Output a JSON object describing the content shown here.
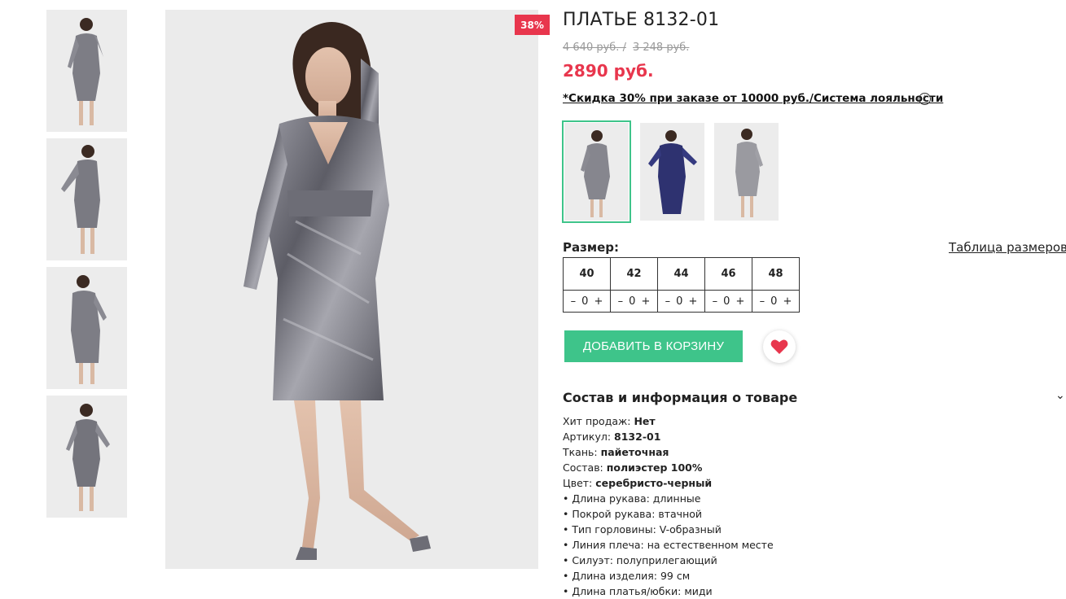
{
  "badge": {
    "discount": "38%"
  },
  "product": {
    "title": "ПЛАТЬЕ 8132-01",
    "old_price_1": "4 640 руб. /",
    "old_price_2": "3 248 руб.",
    "price": "2890 руб.",
    "promo_link": "*Скидка 30% при заказе от 10000 руб./Система лояльности"
  },
  "colors": {
    "silver": "#8a8a92",
    "navy": "#2e3270",
    "accent_green": "#3ec48a",
    "accent_red": "#e8364d"
  },
  "sizes": {
    "label": "Размер:",
    "table_link": "Таблица размеров",
    "items": [
      {
        "size": "40",
        "qty": "0"
      },
      {
        "size": "42",
        "qty": "0"
      },
      {
        "size": "44",
        "qty": "0"
      },
      {
        "size": "46",
        "qty": "0"
      },
      {
        "size": "48",
        "qty": "0"
      }
    ],
    "minus": "–",
    "plus": "+"
  },
  "actions": {
    "add_to_cart": "ДОБАВИТЬ В КОРЗИНУ"
  },
  "details": {
    "title": "Состав и информация о товаре",
    "rows": [
      {
        "label": "Хит продаж:",
        "value": "Нет"
      },
      {
        "label": "Артикул:",
        "value": "8132-01"
      },
      {
        "label": "Ткань:",
        "value": "пайеточная"
      },
      {
        "label": "Состав:",
        "value": "полиэстер 100%"
      },
      {
        "label": "Цвет:",
        "value": "серебристо-черный"
      }
    ],
    "bullets": [
      "• Длина рукава: длинные",
      "• Покрой рукава: втачной",
      "• Тип горловины: V-образный",
      "• Линия плеча: на естественном месте",
      "• Силуэт: полуприлегающий",
      "• Длина изделия: 99 см",
      "• Длина платья/юбки: миди"
    ]
  }
}
